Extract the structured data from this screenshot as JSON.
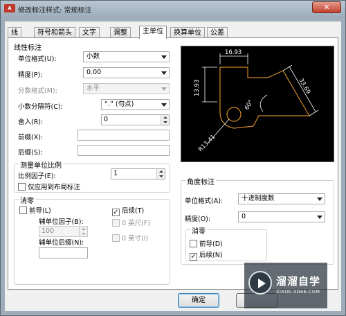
{
  "window": {
    "app_icon_text": "A",
    "title": "修改标注样式: 常规标注",
    "close_label": "✕"
  },
  "tabs": [
    "线",
    "符号和箭头",
    "文字",
    "调整",
    "主单位",
    "换算单位",
    "公差"
  ],
  "active_tab": "主单位",
  "linear": {
    "title": "线性标注",
    "unit_format_label": "单位格式(U):",
    "unit_format_value": "小数",
    "precision_label": "精度(P):",
    "precision_value": "0.00",
    "fraction_format_label": "分数格式(M):",
    "fraction_format_value": "水平",
    "decimal_sep_label": "小数分隔符(C):",
    "decimal_sep_value": "“.” (句点)",
    "roundoff_label": "舍入(R):",
    "roundoff_value": "0",
    "prefix_label": "前缀(X):",
    "prefix_value": "",
    "suffix_label": "后缀(S):",
    "suffix_value": ""
  },
  "measurement_scale": {
    "title": "测量单位比例",
    "scale_factor_label": "比例因子(E):",
    "scale_factor_value": "1",
    "apply_layout_label": "仅应用到布局标注",
    "apply_layout_checked": false
  },
  "zero_suppression": {
    "title": "消零",
    "leading_label": "前导(L)",
    "leading_checked": false,
    "trailing_label": "后续(T)",
    "trailing_checked": true,
    "sub_units_factor_label": "辅单位因子(B):",
    "sub_units_factor_value": "100",
    "feet_label": "0 英尺(F)",
    "inches_label": "0 英寸(I)",
    "sub_units_suffix_label": "辅单位后缀(N):",
    "sub_units_suffix_value": ""
  },
  "angular": {
    "title": "角度标注",
    "unit_format_label": "单位格式(A):",
    "unit_format_value": "十进制度数",
    "precision_label": "精度(O):",
    "precision_value": "0",
    "zero_title": "消零",
    "leading_label": "前导(D)",
    "leading_checked": false,
    "trailing_label": "后续(N)",
    "trailing_checked": true
  },
  "preview": {
    "dim_top": "16.93",
    "dim_left": "13.93",
    "dim_diag": "33.69",
    "dim_angle": "60°",
    "dim_radius": "R13.41"
  },
  "buttons": {
    "ok": "确定"
  },
  "watermark": {
    "name": "溜溜自学",
    "url": "ZIXUE.3D66.COM"
  },
  "colors": {
    "dialog_bg": "#f0f0f0",
    "frame": "#9eadb9",
    "preview_bg": "#000000",
    "preview_geometry": "#d08a2a",
    "preview_dimension": "#ffffff",
    "close_button": "#c4402c"
  }
}
